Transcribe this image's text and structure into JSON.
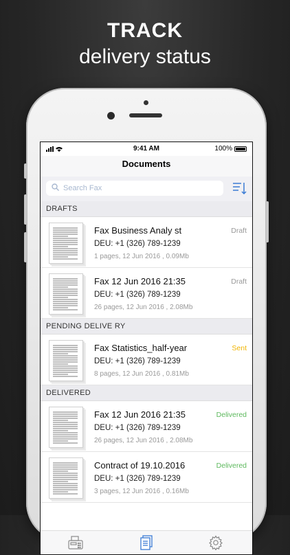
{
  "promo": {
    "headline": "TRACK",
    "subline": "delivery status"
  },
  "status_bar": {
    "time": "9:41 AM",
    "battery": "100%"
  },
  "header": {
    "title": "Documents"
  },
  "search": {
    "placeholder": "Search Fax"
  },
  "colors": {
    "accent": "#3a7bd5",
    "sent": "#f0b400",
    "delivered": "#5cb85c",
    "draft": "#999999"
  },
  "sections": [
    {
      "label": "DRAFTS",
      "items": [
        {
          "title": "Fax Business Analy st",
          "number": "DEU: +1 (326) 789-1239",
          "meta": "1 pages, 12 Jun 2016 , 0.09Mb",
          "status": "Draft",
          "status_kind": "draft"
        },
        {
          "title": "Fax 12 Jun 2016 21:35",
          "number": "DEU: +1 (326) 789-1239",
          "meta": "26 pages, 12 Jun 2016 , 2.08Mb",
          "status": "Draft",
          "status_kind": "draft"
        }
      ]
    },
    {
      "label": "PENDING DELIVE RY",
      "items": [
        {
          "title": "Fax Statistics_half-year",
          "number": "DEU: +1 (326) 789-1239",
          "meta": "8 pages, 12 Jun 2016 , 0.81Mb",
          "status": "Sent",
          "status_kind": "sent"
        }
      ]
    },
    {
      "label": "DELIVERED",
      "items": [
        {
          "title": "Fax 12 Jun 2016 21:35",
          "number": "DEU: +1 (326) 789-1239",
          "meta": "26 pages, 12 Jun 2016 , 2.08Mb",
          "status": "Delivered",
          "status_kind": "delivered"
        },
        {
          "title": "Contract of 19.10.2016",
          "number": "DEU: +1 (326) 789-1239",
          "meta": "3 pages, 12 Jun 2016 , 0.16Mb",
          "status": "Delivered",
          "status_kind": "delivered"
        }
      ]
    }
  ],
  "tabs": [
    {
      "icon": "fax-machine-icon"
    },
    {
      "icon": "documents-icon"
    },
    {
      "icon": "gear-icon"
    }
  ]
}
